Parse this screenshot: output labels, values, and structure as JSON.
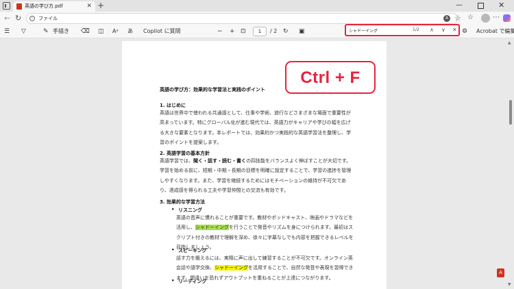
{
  "tab": {
    "title": "英語の学び方.pdf",
    "close": "✕"
  },
  "window": {
    "new_tab": "+",
    "minimize": "—",
    "close": "✕"
  },
  "address": {
    "back": "←",
    "refresh": "↻",
    "info": "i",
    "url": "ファイル"
  },
  "toolbar": {
    "draw_label": "手描き",
    "read_aloud": "Aᵃ",
    "translate": "あ",
    "copilot_label": "Copilot に質問",
    "zoom_out": "−",
    "zoom_in": "+",
    "page_current": "1",
    "page_total": "/ 2",
    "acrobat_label": "Acrobat で編集"
  },
  "find": {
    "query": "シャドーイング",
    "count": "1/2",
    "prev": "∧",
    "next": "∨",
    "close": "✕"
  },
  "annotation": {
    "shortcut": "Ctrl + F",
    "color": "#e8213c"
  },
  "doc": {
    "title": "英語の学び方：効果的な学習法と実践のポイント",
    "s1": {
      "heading": "1. はじめに",
      "lines": [
        "英語は世界中で使われる共通語として、仕事や学術、旅行などさまざまな場面で重要性が",
        "高まっています。特にグローバル化が進む現代では、英語力がキャリアや学びの幅を広げ",
        "る大きな要素となります。本レポートでは、効果的かつ実践的な英語学習法を整理し、学",
        "習のポイントを提案します。"
      ]
    },
    "s2": {
      "heading": "2. 英語学習の基本方針",
      "line1_pre": "英語学習では、",
      "line1_bold": "聞く・話す・読む・書く",
      "line1_post": "の四技能をバランスよく伸ばすことが大切です。",
      "lines": [
        "学習を始める前に、短期・中期・長期の目標を明確に設定することで、学習の進捗を管理",
        "しやすくなります。また、学習を継続するためにはモチベーションの維持が不可欠であ",
        "り、達成感を得られる工夫や学習仲間との交流も有効です。"
      ]
    },
    "s3": {
      "heading": "3. 効果的な学習方法",
      "listening": {
        "label": "リスニング",
        "line1": "英語の音声に慣れることが重要です。教材やポッドキャスト、映画やドラマなどを",
        "line2_pre": "活用し、",
        "line2_hl": "シャドーイング",
        "line2_post": "を行うことで発音やリズムを身につけられます。最初はス",
        "line3": "クリプト付きの教材で理解を深め、徐々に字幕なしでも内容を把握できるレベルを",
        "line4": "目指しましょう。"
      },
      "speaking": {
        "label": "スピーキング",
        "line1": "話す力を鍛えるには、実際に声に出して練習することが不可欠です。オンライン英",
        "line2_pre": "会話や語学交換、",
        "line2_hl": "シャドーイング",
        "line2_post": "を活用することで、自然な発音や表現を習得でき",
        "line3": "ます。間違いを恐れずアウトプットを重ねることが上達につながります。"
      },
      "reading": {
        "label": "リーディング"
      },
      "bullet": "•"
    }
  },
  "icons": {
    "sidebar": "sidebar-icon",
    "filter": "filter-icon",
    "draw": "pen-icon",
    "eraser": "eraser-icon",
    "page_view": "page-view-icon",
    "fit": "fit-page-icon",
    "rotate": "rotate-icon",
    "immersive": "immersive-reader-icon",
    "settings": "settings-icon",
    "acrobat": "acrobat-icon"
  }
}
